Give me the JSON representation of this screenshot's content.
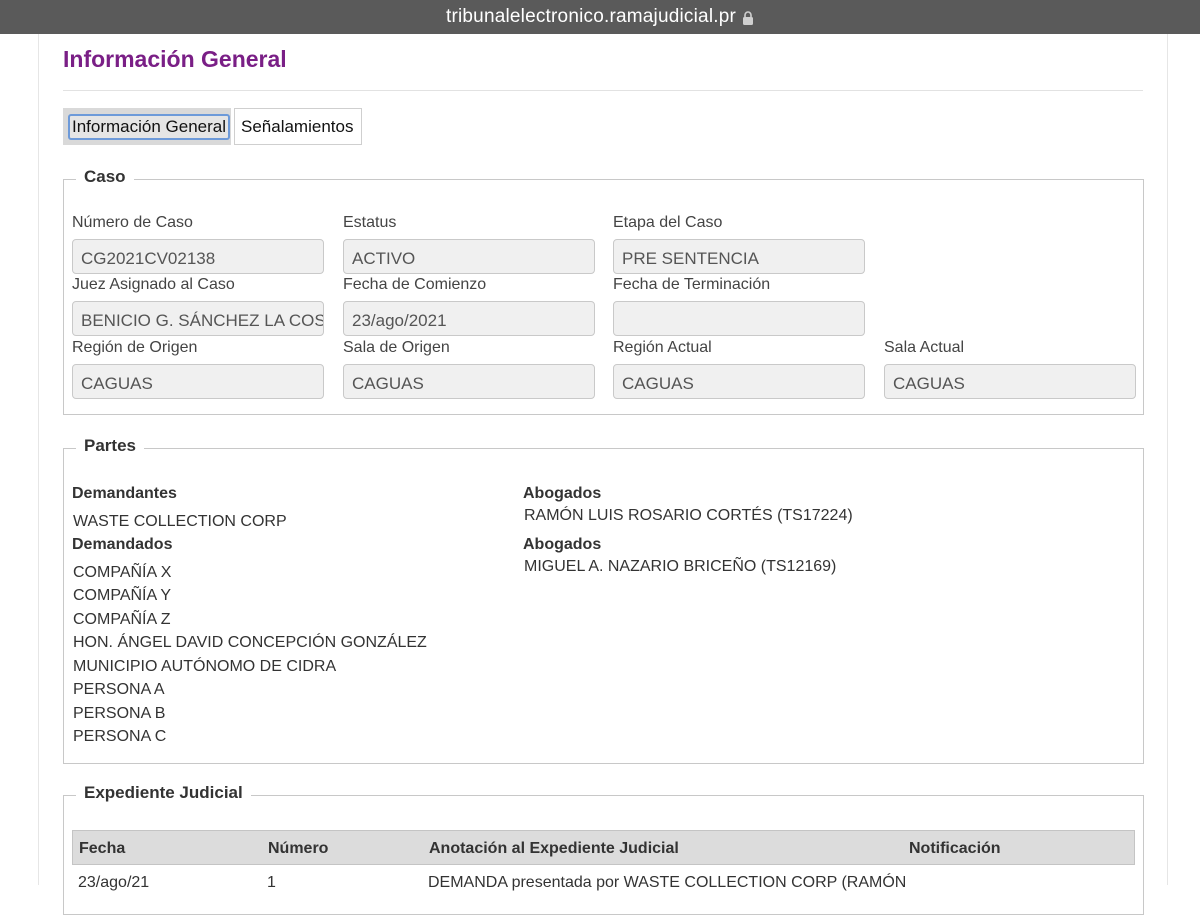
{
  "browser": {
    "url": "tribunalelectronico.ramajudicial.pr"
  },
  "page": {
    "title": "Información General"
  },
  "tabs": [
    {
      "label": "Información General",
      "active": true
    },
    {
      "label": "Señalamientos",
      "active": false
    }
  ],
  "caso": {
    "legend": "Caso",
    "fields": [
      {
        "label": "Número de Caso",
        "value": "CG2021CV02138"
      },
      {
        "label": "Estatus",
        "value": "ACTIVO"
      },
      {
        "label": "Etapa del Caso",
        "value": "PRE SENTENCIA"
      },
      {
        "label": "Juez Asignado al Caso",
        "value": "BENICIO G. SÁNCHEZ LA COSTA"
      },
      {
        "label": "Fecha de Comienzo",
        "value": "23/ago/2021"
      },
      {
        "label": "Fecha de Terminación",
        "value": ""
      },
      {
        "label": "Región de Origen",
        "value": "CAGUAS"
      },
      {
        "label": "Sala de Origen",
        "value": "CAGUAS"
      },
      {
        "label": "Región Actual",
        "value": "CAGUAS"
      },
      {
        "label": "Sala Actual",
        "value": "CAGUAS"
      }
    ]
  },
  "partes": {
    "legend": "Partes",
    "demandantes_label": "Demandantes",
    "demandantes": [
      "WASTE COLLECTION CORP"
    ],
    "abogados_label_1": "Abogados",
    "abogados_1": [
      "RAMÓN LUIS ROSARIO CORTÉS (TS17224)"
    ],
    "demandados_label": "Demandados",
    "demandados": [
      "COMPAÑÍA X",
      "COMPAÑÍA Y",
      "COMPAÑÍA Z",
      "HON. ÁNGEL DAVID CONCEPCIÓN GONZÁLEZ",
      "MUNICIPIO AUTÓNOMO DE CIDRA",
      "PERSONA A",
      "PERSONA B",
      "PERSONA C"
    ],
    "abogados_label_2": "Abogados",
    "abogados_2": [
      "MIGUEL A. NAZARIO BRICEÑO (TS12169)"
    ]
  },
  "expediente": {
    "legend": "Expediente Judicial",
    "columns": [
      "Fecha",
      "Número",
      "Anotación al Expediente Judicial",
      "Notificación"
    ],
    "rows": [
      {
        "fecha": "23/ago/21",
        "numero": "1",
        "anotacion": "DEMANDA presentada por WASTE COLLECTION CORP (RAMÓN",
        "notificacion": ""
      }
    ]
  }
}
